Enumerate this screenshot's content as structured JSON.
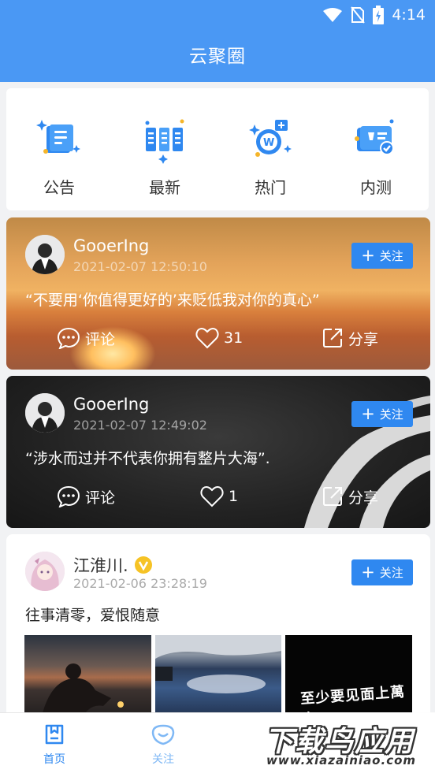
{
  "status_bar": {
    "time": "4:14"
  },
  "header": {
    "title": "云聚圈"
  },
  "quick_menu": [
    {
      "label": "公告",
      "icon": "announcement-icon"
    },
    {
      "label": "最新",
      "icon": "latest-icon"
    },
    {
      "label": "热门",
      "icon": "hot-icon"
    },
    {
      "label": "内测",
      "icon": "beta-icon"
    }
  ],
  "follow_label": "关注",
  "posts": [
    {
      "user": "GooerIng",
      "time": "2021-02-07 12:50:10",
      "content": "“不要用‘你值得更好的’来贬低我对你的真心”",
      "comment_label": "评论",
      "likes": "31",
      "share_label": "分享"
    },
    {
      "user": "GooerIng",
      "time": "2021-02-07 12:49:02",
      "content": "“涉水而过并不代表你拥有整片大海”.",
      "comment_label": "评论",
      "likes": "1",
      "share_label": "分享"
    },
    {
      "user": "江淮川.",
      "time": "2021-02-06 23:28:19",
      "content": "往事清零，爱恨随意",
      "image3_text": "至少要见面上萬次"
    }
  ],
  "bottom_nav": [
    {
      "label": "首页",
      "icon": "home-icon",
      "active": true
    },
    {
      "label": "关注",
      "icon": "heart-chat-icon",
      "active": false
    }
  ],
  "watermark": {
    "main": "下载鸟应用",
    "url": "www.xiazainiao.com"
  },
  "colors": {
    "primary": "#4a98f4",
    "follow_button": "#2f88f0",
    "verified": "#f6c325"
  }
}
